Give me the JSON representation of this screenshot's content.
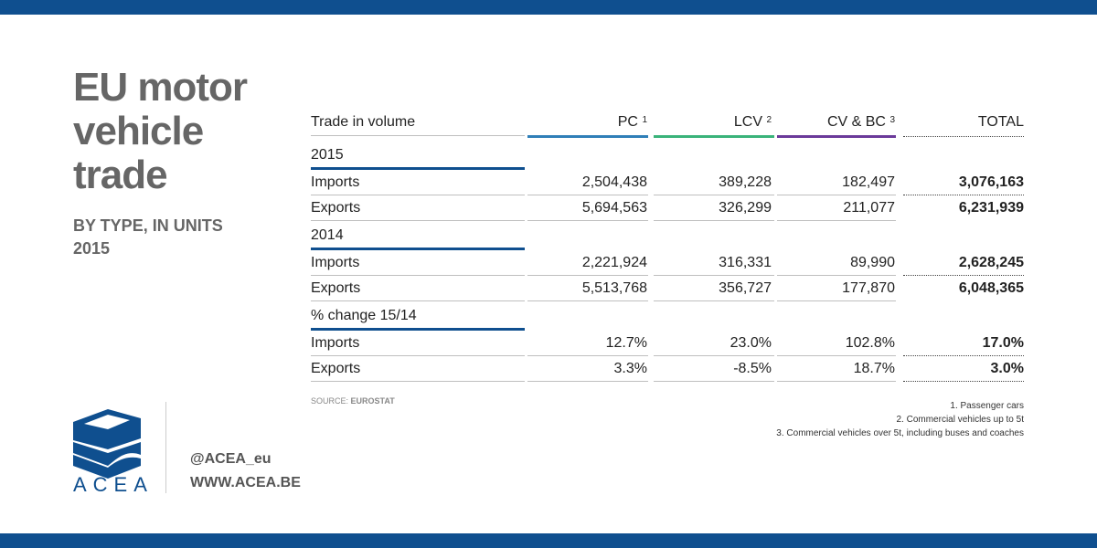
{
  "title": "EU motor vehicle trade",
  "subtitle_line1": "BY TYPE, IN UNITS",
  "subtitle_line2": "2015",
  "colors": {
    "brand_blue": "#0f4f8f",
    "pc": "#2f7fb8",
    "lcv": "#3ab37a",
    "cv": "#6b3a9a"
  },
  "table": {
    "header": {
      "label": "Trade in volume",
      "pc": "PC",
      "pc_sup": "1",
      "lcv": "LCV",
      "lcv_sup": "2",
      "cv": "CV & BC",
      "cv_sup": "3",
      "total": "TOTAL"
    },
    "sections": [
      {
        "label": "2015",
        "rows": [
          {
            "label": "Imports",
            "pc": "2,504,438",
            "lcv": "389,228",
            "cv": "182,497",
            "total": "3,076,163"
          },
          {
            "label": "Exports",
            "pc": "5,694,563",
            "lcv": "326,299",
            "cv": "211,077",
            "total": "6,231,939"
          }
        ]
      },
      {
        "label": "2014",
        "rows": [
          {
            "label": "Imports",
            "pc": "2,221,924",
            "lcv": "316,331",
            "cv": "89,990",
            "total": "2,628,245"
          },
          {
            "label": "Exports",
            "pc": "5,513,768",
            "lcv": "356,727",
            "cv": "177,870",
            "total": "6,048,365"
          }
        ]
      },
      {
        "label": "% change 15/14",
        "rows": [
          {
            "label": "Imports",
            "pc": "12.7%",
            "lcv": "23.0%",
            "cv": "102.8%",
            "total": "17.0%"
          },
          {
            "label": "Exports",
            "pc": "3.3%",
            "lcv": "-8.5%",
            "cv": "18.7%",
            "total": "3.0%"
          }
        ]
      }
    ]
  },
  "source_prefix": "SOURCE:",
  "source_name": "EUROSTAT",
  "notes": [
    "1. Passenger cars",
    "2. Commercial vehicles up to 5t",
    "3. Commercial vehicles over 5t, including buses and coaches"
  ],
  "logo_text": "ACEA",
  "social_handle": "@ACEA_eu",
  "website": "WWW.ACEA.BE"
}
